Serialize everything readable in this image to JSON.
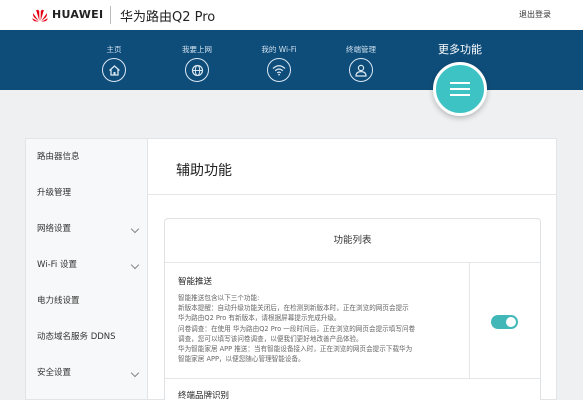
{
  "header": {
    "brand": "HUAWEI",
    "product": "华为路由Q2 Pro",
    "logout": "退出登录"
  },
  "nav": {
    "items": [
      {
        "label": "主页",
        "icon": "home-icon"
      },
      {
        "label": "我要上网",
        "icon": "globe-icon"
      },
      {
        "label": "我的 Wi-Fi",
        "icon": "wifi-icon"
      },
      {
        "label": "终端管理",
        "icon": "user-icon"
      }
    ],
    "more": {
      "label": "更多功能",
      "icon": "menu-icon"
    }
  },
  "sidebar": {
    "items": [
      {
        "label": "路由器信息",
        "expandable": false
      },
      {
        "label": "升级管理",
        "expandable": false
      },
      {
        "label": "网络设置",
        "expandable": true
      },
      {
        "label": "Wi-Fi 设置",
        "expandable": true
      },
      {
        "label": "电力线设置",
        "expandable": false
      },
      {
        "label": "动态域名服务 DDNS",
        "expandable": false
      },
      {
        "label": "安全设置",
        "expandable": true
      }
    ]
  },
  "main": {
    "title": "辅助功能",
    "panel_title": "功能列表",
    "features": [
      {
        "name": "智能推送",
        "desc": [
          "智能推送包含以下三个功能:",
          "新版本提醒：自动升级功能关闭后，在检测到新版本时，正在浏览的网页会提示",
          "华为路由Q2 Pro 有新版本，请根据屏幕提示完成升级。",
          "问卷调查：在使用 华为路由Q2 Pro 一段时间后，正在浏览的网页会提示填写问卷",
          "调查，您可以填写该问卷调查，以便我们更好地改善产品体验。",
          "华为智能家居 APP 推送：当有智能设备接入时，正在浏览的网页会提示下载华为",
          "智能家居 APP，以便您随心管理智能设备。"
        ],
        "enabled": true
      },
      {
        "name": "终端品牌识别"
      }
    ]
  },
  "colors": {
    "nav_bg": "#0e4d7a",
    "accent": "#3ec3c5",
    "toggle_on": "#41b8b7",
    "brand_red": "#e60012"
  }
}
